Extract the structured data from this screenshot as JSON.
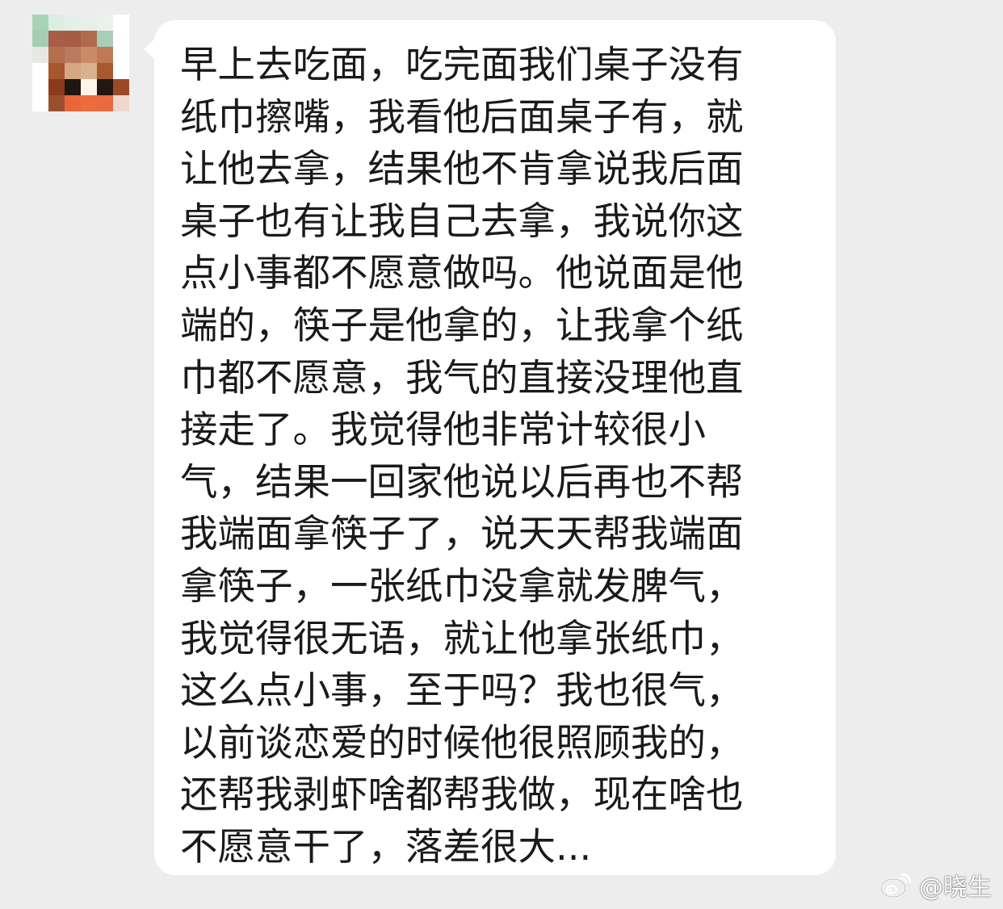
{
  "chat": {
    "avatar": {
      "icon": "pixelated-avatar-icon",
      "pixels": [
        [
          "#a8d2b6",
          "#dcede4",
          "#e4efe8",
          "#e6efe9",
          "#ebf2ed",
          "#ffffff"
        ],
        [
          "#a4cdb4",
          "#a85d46",
          "#a65c43",
          "#b06b4f",
          "#a9cdb8",
          "#ffffff"
        ],
        [
          "#e6e8e4",
          "#b46f4c",
          "#b87a60",
          "#c98a66",
          "#bd7a55",
          "#ffffff"
        ],
        [
          "#ffffff",
          "#a7562f",
          "#d6a685",
          "#d8b28c",
          "#a65a30",
          "#ffffff"
        ],
        [
          "#ffffff",
          "#8c3a1a",
          "#1e1612",
          "#fff4e8",
          "#221713",
          "#9c4a26"
        ],
        [
          "#ffffff",
          "#98502e",
          "#e8663a",
          "#ec6c3f",
          "#e86a41",
          "#ecd8cc"
        ]
      ]
    },
    "message": {
      "lines": [
        "早上去吃面，吃完面我们桌子没有",
        "纸巾擦嘴，我看他后面桌子有，就",
        "让他去拿，结果他不肯拿说我后面",
        "桌子也有让我自己去拿，我说你这",
        "点小事都不愿意做吗。他说面是他",
        "端的，筷子是他拿的，让我拿个纸",
        "巾都不愿意，我气的直接没理他直",
        "接走了。我觉得他非常计较很小",
        "气，结果一回家他说以后再也不帮",
        "我端面拿筷子了，说天天帮我端面",
        "拿筷子，一张纸巾没拿就发脾气，",
        "我觉得很无语，就让他拿张纸巾，",
        "这么点小事，至于吗？我也很气，",
        "以前谈恋爱的时候他很照顾我的，",
        "还帮我剥虾啥都帮我做，现在啥也",
        "不愿意干了，落差很大..."
      ]
    }
  },
  "watermark": {
    "icon": "weibo-logo-icon",
    "handle": "@晓生"
  },
  "colors": {
    "background": "#ededed",
    "bubble": "#ffffff",
    "text": "#1a1a1a"
  }
}
